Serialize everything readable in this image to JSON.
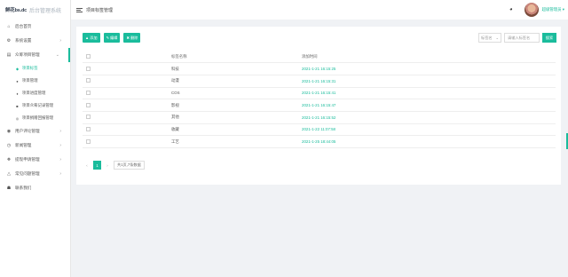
{
  "logo": {
    "mark": "鲜花bs.dc",
    "title": "后台管理系统"
  },
  "header": {
    "page_title": "项目标签管理",
    "user_name": "超级管理员",
    "user_arrow": "▾"
  },
  "sidebar": {
    "items": [
      {
        "label": "后台首页",
        "icon": "home-icon"
      },
      {
        "label": "系统设置",
        "icon": "gear-icon",
        "arrow": "›"
      },
      {
        "label": "众筹项目管理",
        "icon": "folder-icon",
        "arrow": "⌄"
      },
      {
        "label": "用户评论管理",
        "icon": "comment-icon",
        "arrow": "›"
      },
      {
        "label": "新闻管理",
        "icon": "news-icon",
        "arrow": "›"
      },
      {
        "label": "提现申请管理",
        "icon": "money-icon",
        "arrow": "›"
      },
      {
        "label": "常见问题管理",
        "icon": "warning-icon",
        "arrow": "›"
      },
      {
        "label": "联系我们",
        "icon": "contact-icon"
      }
    ],
    "sub_items": [
      {
        "label": "项目标签",
        "icon": "tag-icon"
      },
      {
        "label": "项目管理",
        "icon": "list-icon"
      },
      {
        "label": "项目进度管理",
        "icon": "progress-icon"
      },
      {
        "label": "项目众筹记录管理",
        "icon": "record-icon"
      },
      {
        "label": "项目捐赠回报管理",
        "icon": "gift-icon"
      }
    ]
  },
  "toolbar": {
    "add": "添加",
    "edit": "编辑",
    "delete": "删除"
  },
  "search": {
    "select_value": "标签名",
    "select_arrow": "⌄",
    "placeholder": "请输入标签名",
    "button": "搜索"
  },
  "table": {
    "headers": [
      "标签名称",
      "添加时间"
    ],
    "rows": [
      {
        "name": "科技",
        "time": "2021-1-21 16:15:25"
      },
      {
        "name": "动漫",
        "time": "2021-1-21 16:15:31"
      },
      {
        "name": "COS",
        "time": "2021-1-21 16:15:41"
      },
      {
        "name": "影视",
        "time": "2021-1-21 16:15:47"
      },
      {
        "name": "其他",
        "time": "2021-1-21 16:15:52"
      },
      {
        "name": "收藏",
        "time": "2021-1-22 11:07:58"
      },
      {
        "name": "工艺",
        "time": "2021-1-25 18:44:05"
      }
    ]
  },
  "pager": {
    "prev": "‹",
    "current": "1",
    "next": "›",
    "total_text": "共1页,7条数据"
  },
  "colors": {
    "accent": "#1abc9c"
  }
}
